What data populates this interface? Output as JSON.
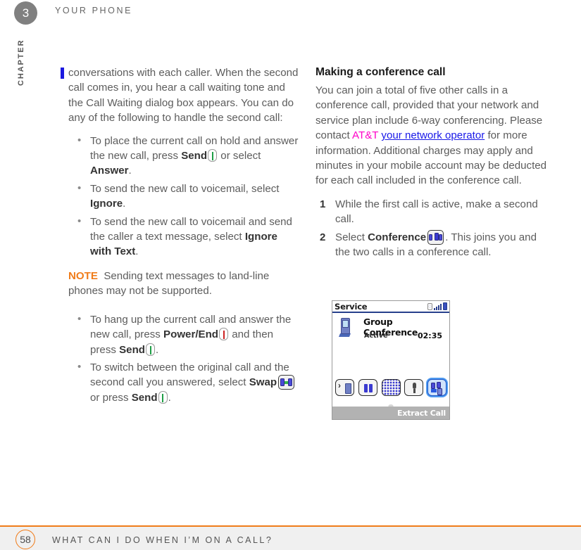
{
  "header": {
    "chapter_number": "3",
    "chapter_label": "CHAPTER",
    "title": "YOUR PHONE"
  },
  "left_column": {
    "intro": "conversations with each caller. When the second call comes in, you hear a call waiting tone and the Call Waiting dialog box appears. You can do any of the following to handle the second call:",
    "bullets": [
      {
        "part1": "To place the current call on hold and answer the new call, press ",
        "bold1": "Send",
        "icon1": "send-key-icon",
        "part2": " or select ",
        "bold2": "Answer",
        "part3": "."
      },
      {
        "part1": "To send the new call to voicemail, select ",
        "bold1": "Ignore",
        "part2": "."
      },
      {
        "part1": "To send the new call to voicemail and send the caller a text message, select ",
        "bold1": "Ignore with Text",
        "part2": "."
      }
    ],
    "note": {
      "label": "NOTE",
      "text": "Sending text messages to land-line phones may not be supported."
    },
    "bullets2": [
      {
        "part1": "To hang up the current call and answer the new call, press ",
        "bold1": "Power/End",
        "icon1": "power-end-key-icon",
        "part2": " and then press ",
        "bold2": "Send",
        "icon2": "send-key-icon",
        "part3": "."
      },
      {
        "part1": "To switch between the original call and the second call you answered, select ",
        "bold1": "Swap",
        "icon1": "swap-button-icon",
        "part2": " or press ",
        "bold2": "Send",
        "icon2": "send-key-icon",
        "part3": "."
      }
    ]
  },
  "right_column": {
    "heading": "Making a conference call",
    "paragraph": {
      "part1": "You can join a total of five other calls in a conference call, provided that your network and service plan include 6-way conferencing. Please contact ",
      "carrier": "AT&T",
      "link": "your network operator",
      "part2": " for more information. Additional charges may apply and minutes in your mobile account may be deducted for each call included in the conference call."
    },
    "steps": [
      {
        "text": "While the first call is active, make a second call."
      },
      {
        "part1": "Select ",
        "bold1": "Conference",
        "icon1": "conference-button-icon",
        "part2": ". This joins you and the two calls in a conference call."
      }
    ]
  },
  "phone_screenshot": {
    "title_bar": {
      "label": "Service",
      "icons": [
        "bluetooth-icon",
        "signal-strength-icon",
        "battery-icon"
      ]
    },
    "call": {
      "contact_icon": "cellphone-icon",
      "name": "Group Conference",
      "status": "Active",
      "duration": "02:35"
    },
    "buttons": [
      {
        "name": "add-call-button",
        "selected": false
      },
      {
        "name": "hold-button",
        "selected": false
      },
      {
        "name": "keypad-button",
        "selected": false
      },
      {
        "name": "mute-button",
        "selected": false
      },
      {
        "name": "extract-call-button",
        "selected": true
      }
    ],
    "footer_label": "Extract Call"
  },
  "footer": {
    "page_number": "58",
    "title": "WHAT CAN I DO WHEN I’M ON A CALL?"
  },
  "colors": {
    "accent_orange": "#f07c1a",
    "accent_blue": "#1c19e0",
    "link_blue": "#1a1ae8",
    "carrier_magenta": "#ff00c8",
    "body_gray": "#5c5c5c"
  }
}
